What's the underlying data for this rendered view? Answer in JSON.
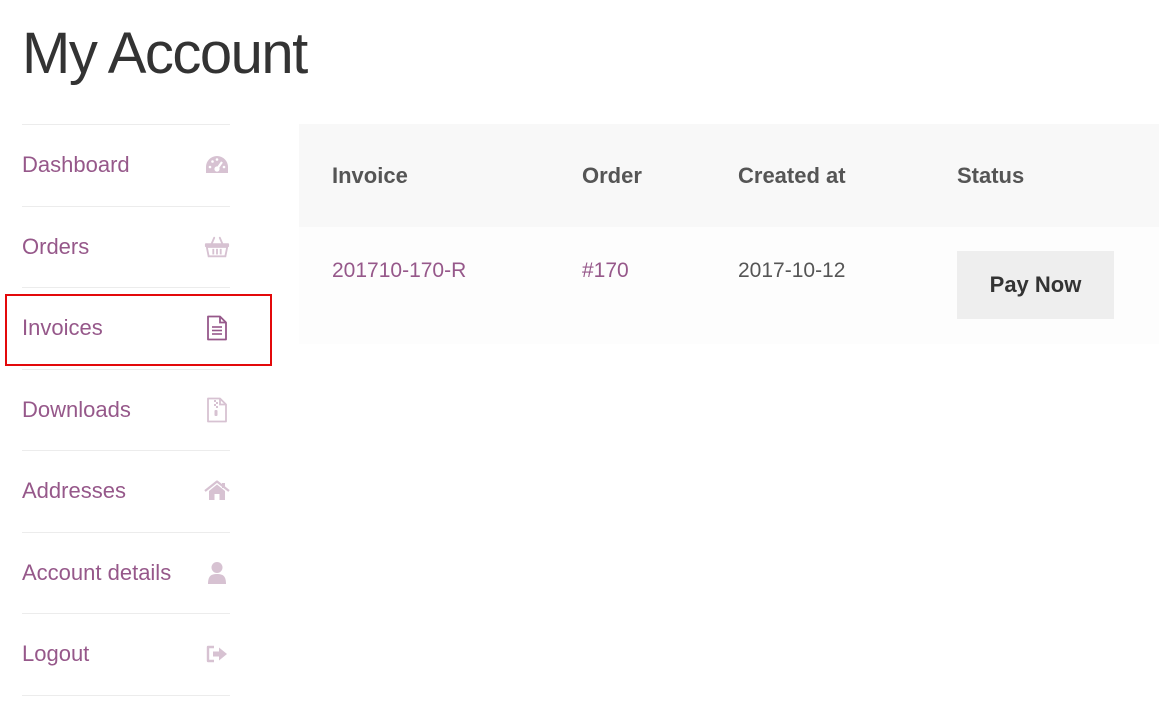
{
  "page": {
    "title": "My Account"
  },
  "sidebar": {
    "items": [
      {
        "label": "Dashboard",
        "icon": "dashboard-icon"
      },
      {
        "label": "Orders",
        "icon": "basket-icon"
      },
      {
        "label": "Invoices",
        "icon": "invoice-file-icon",
        "active": true
      },
      {
        "label": "Downloads",
        "icon": "zip-file-icon"
      },
      {
        "label": "Addresses",
        "icon": "home-icon"
      },
      {
        "label": "Account details",
        "icon": "user-icon"
      },
      {
        "label": "Logout",
        "icon": "sign-out-icon"
      }
    ]
  },
  "invoices_table": {
    "headers": [
      "Invoice",
      "Order",
      "Created at",
      "Status"
    ],
    "rows": [
      {
        "invoice": "201710-170-R",
        "order": "#170",
        "created_at": "2017-10-12",
        "status_button": "Pay Now"
      }
    ]
  },
  "colors": {
    "link": "#96588a",
    "icon_light": "#d7c2d2",
    "icon_active": "#96588a",
    "highlight": "#e3090b"
  }
}
